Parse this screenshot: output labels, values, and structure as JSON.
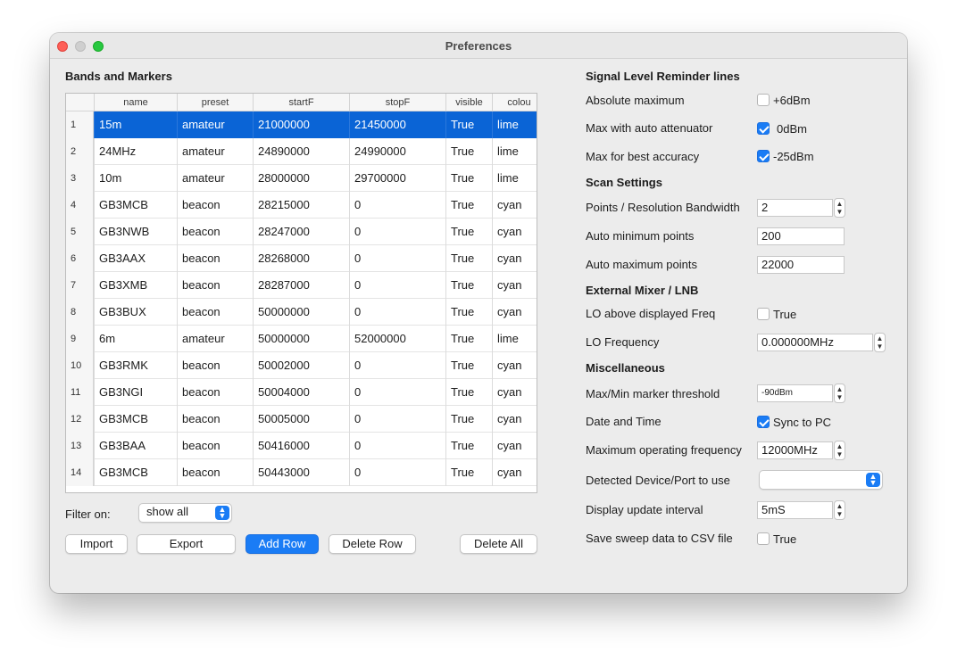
{
  "window": {
    "title": "Preferences"
  },
  "bands": {
    "title": "Bands and Markers",
    "columns": [
      "name",
      "preset",
      "startF",
      "stopF",
      "visible",
      "colou"
    ],
    "rows": [
      {
        "num": "1",
        "name": "15m",
        "preset": "amateur",
        "startF": "21000000",
        "stopF": "21450000",
        "visible": "True",
        "colour": "lime",
        "selected": true
      },
      {
        "num": "2",
        "name": "24MHz",
        "preset": "amateur",
        "startF": "24890000",
        "stopF": "24990000",
        "visible": "True",
        "colour": "lime"
      },
      {
        "num": "3",
        "name": "10m",
        "preset": "amateur",
        "startF": "28000000",
        "stopF": "29700000",
        "visible": "True",
        "colour": "lime"
      },
      {
        "num": "4",
        "name": "GB3MCB",
        "preset": "beacon",
        "startF": "28215000",
        "stopF": "0",
        "visible": "True",
        "colour": "cyan"
      },
      {
        "num": "5",
        "name": "GB3NWB",
        "preset": "beacon",
        "startF": "28247000",
        "stopF": "0",
        "visible": "True",
        "colour": "cyan"
      },
      {
        "num": "6",
        "name": "GB3AAX",
        "preset": "beacon",
        "startF": "28268000",
        "stopF": "0",
        "visible": "True",
        "colour": "cyan"
      },
      {
        "num": "7",
        "name": "GB3XMB",
        "preset": "beacon",
        "startF": "28287000",
        "stopF": "0",
        "visible": "True",
        "colour": "cyan"
      },
      {
        "num": "8",
        "name": "GB3BUX",
        "preset": "beacon",
        "startF": "50000000",
        "stopF": "0",
        "visible": "True",
        "colour": "cyan"
      },
      {
        "num": "9",
        "name": "6m",
        "preset": "amateur",
        "startF": "50000000",
        "stopF": "52000000",
        "visible": "True",
        "colour": "lime"
      },
      {
        "num": "10",
        "name": "GB3RMK",
        "preset": "beacon",
        "startF": "50002000",
        "stopF": "0",
        "visible": "True",
        "colour": "cyan"
      },
      {
        "num": "11",
        "name": "GB3NGI",
        "preset": "beacon",
        "startF": "50004000",
        "stopF": "0",
        "visible": "True",
        "colour": "cyan"
      },
      {
        "num": "12",
        "name": "GB3MCB",
        "preset": "beacon",
        "startF": "50005000",
        "stopF": "0",
        "visible": "True",
        "colour": "cyan"
      },
      {
        "num": "13",
        "name": "GB3BAA",
        "preset": "beacon",
        "startF": "50416000",
        "stopF": "0",
        "visible": "True",
        "colour": "cyan"
      },
      {
        "num": "14",
        "name": "GB3MCB",
        "preset": "beacon",
        "startF": "50443000",
        "stopF": "0",
        "visible": "True",
        "colour": "cyan"
      }
    ],
    "filter_label": "Filter on:",
    "filter_value": "show all",
    "buttons": {
      "import": "Import",
      "export": "Export",
      "add_row": "Add Row",
      "delete_row": "Delete Row",
      "delete_all": "Delete All"
    }
  },
  "signal": {
    "title": "Signal Level Reminder lines",
    "abs_max": {
      "label": "Absolute maximum",
      "value": "+6dBm",
      "checked": false
    },
    "auto_att": {
      "label": "Max with auto attenuator",
      "value": "0dBm",
      "checked": true
    },
    "best_acc": {
      "label": "Max for best accuracy",
      "value": "-25dBm",
      "checked": true
    }
  },
  "scan": {
    "title": "Scan Settings",
    "points_rbw": {
      "label": "Points / Resolution Bandwidth",
      "value": "2"
    },
    "auto_min": {
      "label": "Auto minimum points",
      "value": "200"
    },
    "auto_max": {
      "label": "Auto maximum points",
      "value": "22000"
    }
  },
  "mixer": {
    "title": "External Mixer / LNB",
    "lo_above": {
      "label": "LO above displayed Freq",
      "value": "True",
      "checked": false
    },
    "lo_freq": {
      "label": "LO Frequency",
      "value": "0.000000MHz"
    }
  },
  "misc": {
    "title": "Miscellaneous",
    "marker_threshold": {
      "label": "Max/Min marker threshold",
      "value": "-90dBm"
    },
    "date_time": {
      "label": "Date and Time",
      "value": "Sync to PC",
      "checked": true
    },
    "max_freq": {
      "label": "Maximum operating frequency",
      "value": "12000MHz"
    },
    "device": {
      "label": "Detected Device/Port to use",
      "value": ""
    },
    "update_interval": {
      "label": "Display update interval",
      "value": "5mS"
    },
    "csv": {
      "label": "Save sweep data to CSV file",
      "value": "True",
      "checked": false
    }
  },
  "colors": {
    "accent": "#1a7cf5",
    "selection": "#0a64d6",
    "window_bg": "#ececec"
  }
}
